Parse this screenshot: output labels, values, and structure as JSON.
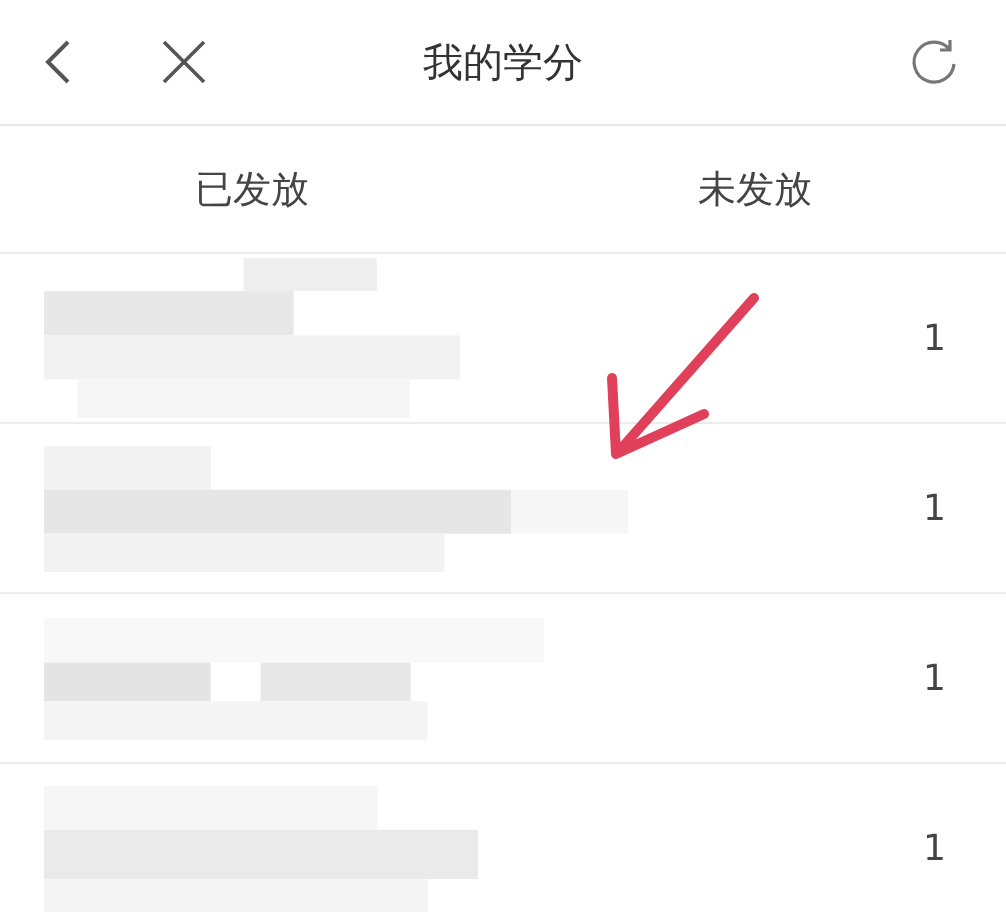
{
  "header": {
    "title": "我的学分"
  },
  "tabs": [
    {
      "label": "已发放"
    },
    {
      "label": "未发放"
    }
  ],
  "rows": [
    {
      "value": "1"
    },
    {
      "value": "1"
    },
    {
      "value": "1"
    },
    {
      "value": "1"
    }
  ]
}
